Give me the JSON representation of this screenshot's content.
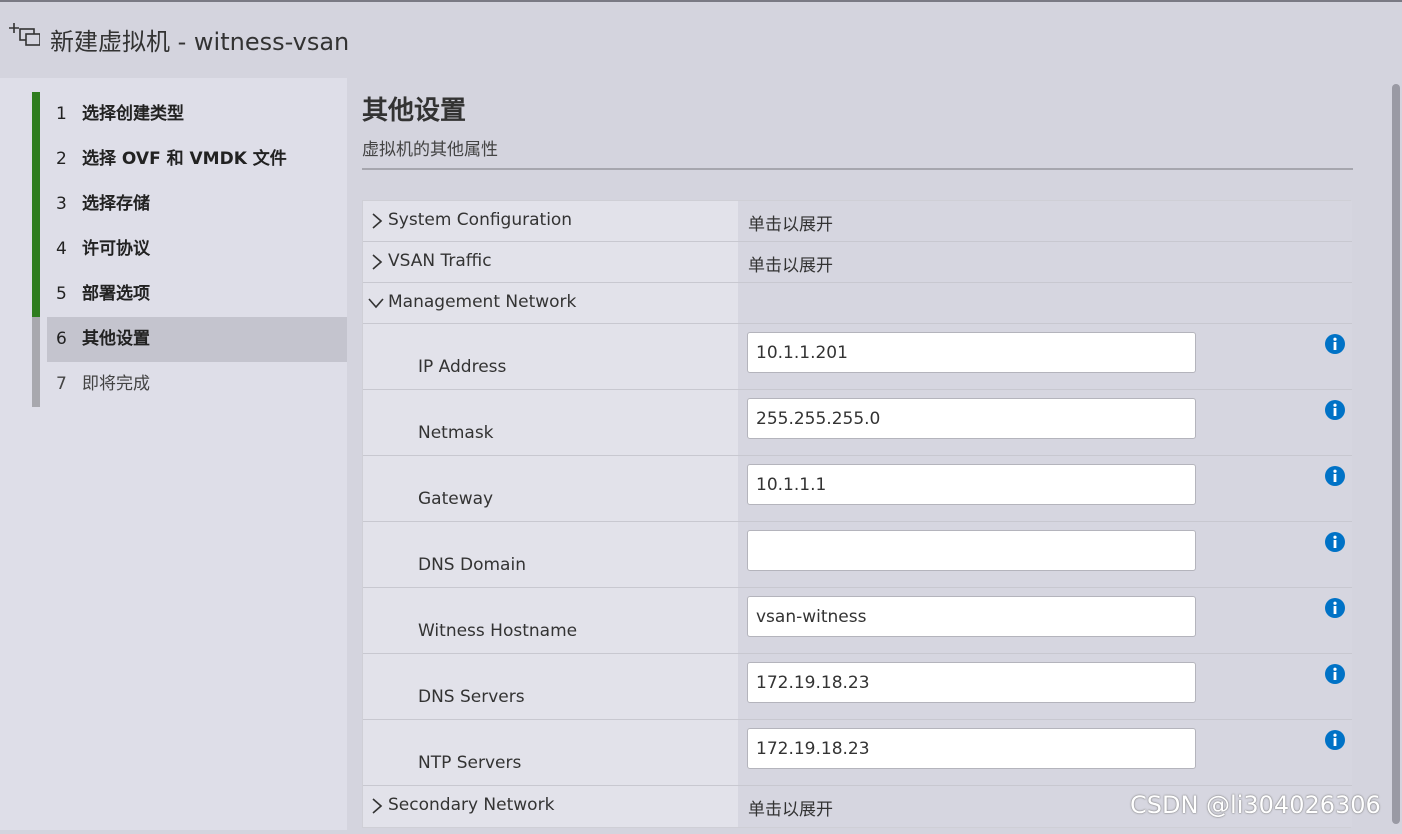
{
  "window": {
    "title": "新建虚拟机 - witness-vsan"
  },
  "wizard": {
    "steps": [
      {
        "num": "1",
        "label": "选择创建类型",
        "state": "done"
      },
      {
        "num": "2",
        "label": "选择 OVF 和 VMDK 文件",
        "state": "done"
      },
      {
        "num": "3",
        "label": "选择存储",
        "state": "done"
      },
      {
        "num": "4",
        "label": "许可协议",
        "state": "done"
      },
      {
        "num": "5",
        "label": "部署选项",
        "state": "done"
      },
      {
        "num": "6",
        "label": "其他设置",
        "state": "active"
      },
      {
        "num": "7",
        "label": "即将完成",
        "state": "pending"
      }
    ]
  },
  "page": {
    "title": "其他设置",
    "subtitle": "虚拟机的其他属性"
  },
  "groups": {
    "system": {
      "label": "System Configuration",
      "value": "单击以展开",
      "expanded": false
    },
    "vsan": {
      "label": "VSAN Traffic",
      "value": "单击以展开",
      "expanded": false
    },
    "management": {
      "label": "Management Network",
      "value": "",
      "expanded": true
    },
    "secondary": {
      "label": "Secondary Network",
      "value": "单击以展开",
      "expanded": false
    }
  },
  "fields": [
    {
      "label": "IP Address",
      "value": "10.1.1.201"
    },
    {
      "label": "Netmask",
      "value": "255.255.255.0"
    },
    {
      "label": "Gateway",
      "value": "10.1.1.1"
    },
    {
      "label": "DNS Domain",
      "value": ""
    },
    {
      "label": "Witness Hostname",
      "value": "vsan-witness"
    },
    {
      "label": "DNS Servers",
      "value": "172.19.18.23"
    },
    {
      "label": "NTP Servers",
      "value": "172.19.18.23"
    }
  ],
  "icons": {
    "info": "info-icon",
    "chevron_right": "chevron-right-icon",
    "chevron_down": "chevron-down-icon",
    "new_vm": "new-vm-icon"
  },
  "colors": {
    "complete_step": "#2f7d1f",
    "info_icon": "#0072c6",
    "active_step_bg": "#c4c4ce"
  },
  "watermark": "CSDN @li304026306"
}
